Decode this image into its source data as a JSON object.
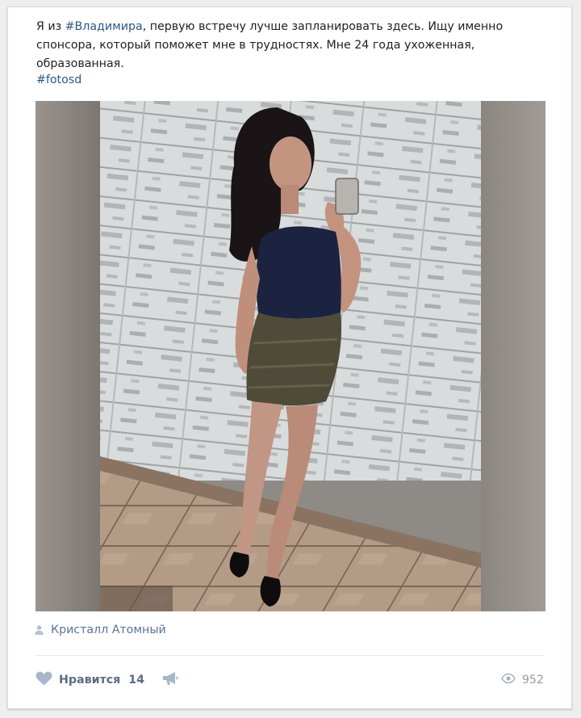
{
  "post": {
    "text_before": "Я из ",
    "hashtag_city": "#Владимира",
    "text_after": ", первую встречу лучше запланировать здесь. Ищу именно спонсора, который поможет мне в трудностях. Мне 24 года ухоженная, образованная.",
    "hashtag": "#fotosd",
    "author": "Кристалл Атомный"
  },
  "actions": {
    "like_label": "Нравится",
    "like_count": "14",
    "views": "952"
  },
  "colors": {
    "link": "#2a5885",
    "action_text": "#5b6d83",
    "muted": "#939ba5",
    "card_bg": "#ffffff",
    "page_bg": "#edeef0"
  },
  "icons": {
    "author": "user-icon",
    "like": "heart-icon",
    "share": "megaphone-icon",
    "views": "eye-icon"
  }
}
